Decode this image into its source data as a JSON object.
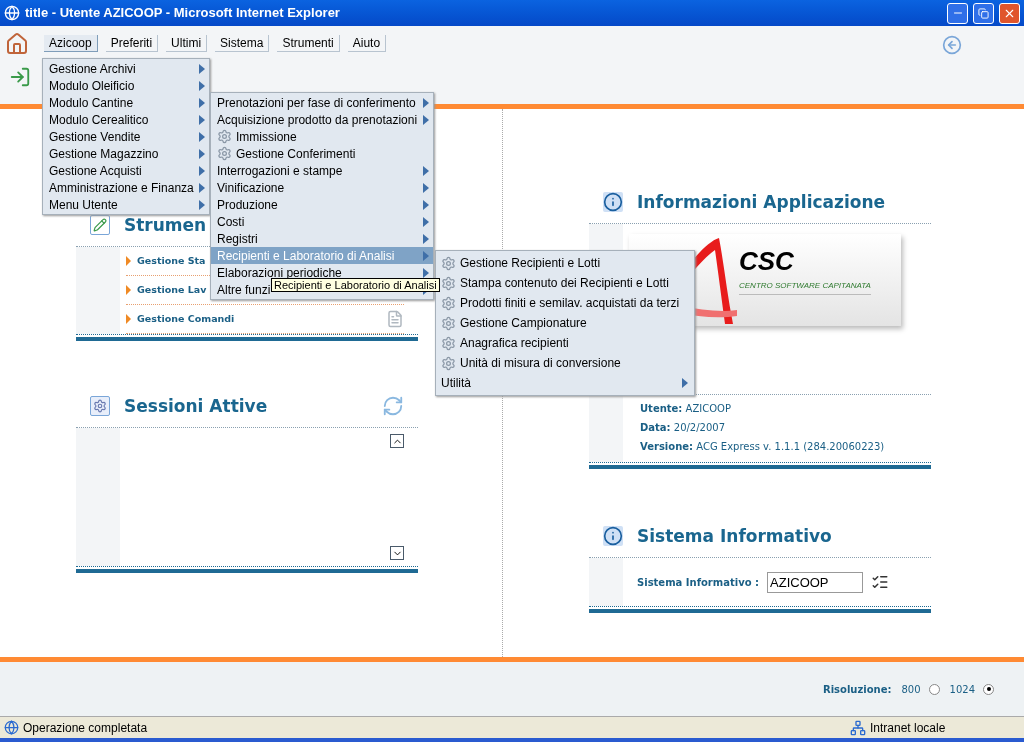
{
  "window": {
    "title": "title - Utente AZICOOP - Microsoft Internet Explorer"
  },
  "menu_bar": [
    {
      "label": "Azicoop",
      "selected": true
    },
    {
      "label": "Preferiti",
      "selected": false
    },
    {
      "label": "Ultimi",
      "selected": false
    },
    {
      "label": "Sistema",
      "selected": false
    },
    {
      "label": "Strumenti",
      "selected": false
    },
    {
      "label": "Aiuto",
      "selected": false
    }
  ],
  "menu": {
    "items": [
      {
        "label": "Gestione Archivi",
        "selected": false
      },
      {
        "label": "Modulo Oleificio",
        "selected": false
      },
      {
        "label": "Modulo Cantine",
        "selected": false
      },
      {
        "label": "Modulo Cerealitico",
        "selected": false
      },
      {
        "label": "Gestione Vendite",
        "selected": false
      },
      {
        "label": "Gestione Magazzino",
        "selected": false
      },
      {
        "label": "Gestione Acquisti",
        "selected": false
      },
      {
        "label": "Amministrazione e Finanza",
        "selected": false
      },
      {
        "label": "Menu Utente",
        "selected": false
      }
    ]
  },
  "submenu": {
    "items": [
      {
        "kind": "submenu",
        "label": "Prenotazioni per fase di conferimento",
        "selected": false
      },
      {
        "kind": "submenu",
        "label": "Acquisizione prodotto da prenotazioni",
        "selected": false
      },
      {
        "kind": "action",
        "label": "Immissione",
        "selected": false
      },
      {
        "kind": "action",
        "label": "Gestione Conferimenti",
        "selected": false
      },
      {
        "kind": "submenu",
        "label": "Interrogazioni e stampe",
        "selected": false
      },
      {
        "kind": "submenu",
        "label": "Vinificazione",
        "selected": false
      },
      {
        "kind": "submenu",
        "label": "Produzione",
        "selected": false
      },
      {
        "kind": "submenu",
        "label": "Costi",
        "selected": false
      },
      {
        "kind": "submenu",
        "label": "Registri",
        "selected": false
      },
      {
        "kind": "submenu",
        "label": "Recipienti e Laboratorio di Analisi",
        "selected": true
      },
      {
        "kind": "submenu",
        "label": "Elaborazioni periodiche",
        "selected": false
      },
      {
        "kind": "submenu",
        "label": "Altre funzi",
        "selected": false
      }
    ]
  },
  "subsubmenu": {
    "items": [
      {
        "kind": "action",
        "label": "Gestione Recipienti e Lotti"
      },
      {
        "kind": "action",
        "label": "Stampa contenuto dei Recipienti e Lotti"
      },
      {
        "kind": "action",
        "label": "Prodotti finiti e semilav. acquistati da terzi"
      },
      {
        "kind": "action",
        "label": "Gestione Campionature"
      },
      {
        "kind": "action",
        "label": "Anagrafica recipienti"
      },
      {
        "kind": "action",
        "label": "Unità di misura di conversione"
      },
      {
        "kind": "submenu",
        "label": "Utilità"
      }
    ]
  },
  "tooltip": "Recipienti e Laboratorio di Analisi",
  "strumenti": {
    "title": "Strumen",
    "rows": [
      "Gestione Sta",
      "Gestione Lav",
      "Gestione Comandi"
    ]
  },
  "sessioni": {
    "title": "Sessioni Attive"
  },
  "info": {
    "title": "Informazioni Applicazione",
    "logo": {
      "name": "CSC",
      "tagline": "CENTRO SOFTWARE CAPITANATA"
    },
    "fields": [
      {
        "label": "Utente:",
        "value": "AZICOOP"
      },
      {
        "label": "Data:",
        "value": "20/2/2007"
      },
      {
        "label": "Versione:",
        "value": "ACG Express v. 1.1.1 (284.20060223)"
      }
    ]
  },
  "sistema": {
    "title": "Sistema Informativo",
    "label": "Sistema Informativo :",
    "value": "AZICOOP"
  },
  "footer": {
    "label": "Risoluzione:",
    "resolutions": [
      {
        "label": "800",
        "selected": false
      },
      {
        "label": "1024",
        "selected": true
      }
    ]
  },
  "status_bar": {
    "text": "Operazione completata",
    "zone": "Intranet locale"
  }
}
